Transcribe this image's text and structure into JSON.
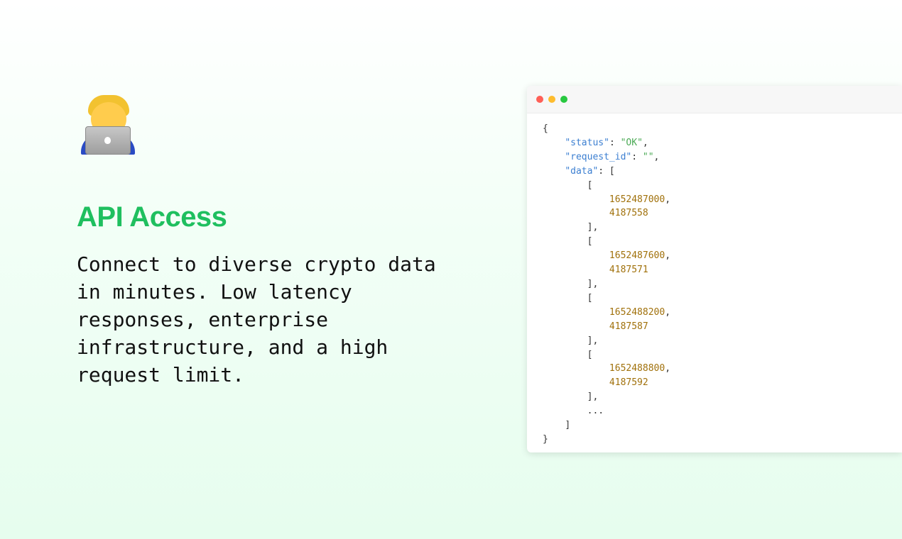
{
  "hero": {
    "title": "API Access",
    "description": "Connect to diverse crypto data in minutes. Low latency responses, enterprise infrastructure, and a high request limit.",
    "icon": "technologist-emoji-icon"
  },
  "code_window": {
    "dot_colors": [
      "#ff5f57",
      "#febc2e",
      "#28c840"
    ],
    "lines": [
      {
        "indent": "",
        "parts": [
          {
            "t": "pun",
            "v": "{"
          }
        ]
      },
      {
        "indent": "    ",
        "parts": [
          {
            "t": "key",
            "v": "\"status\""
          },
          {
            "t": "pun",
            "v": ": "
          },
          {
            "t": "str",
            "v": "\"OK\""
          },
          {
            "t": "pun",
            "v": ","
          }
        ]
      },
      {
        "indent": "    ",
        "parts": [
          {
            "t": "key",
            "v": "\"request_id\""
          },
          {
            "t": "pun",
            "v": ": "
          },
          {
            "t": "str",
            "v": "\"\""
          },
          {
            "t": "pun",
            "v": ","
          }
        ]
      },
      {
        "indent": "    ",
        "parts": [
          {
            "t": "key",
            "v": "\"data\""
          },
          {
            "t": "pun",
            "v": ": ["
          }
        ]
      },
      {
        "indent": "        ",
        "parts": [
          {
            "t": "pun",
            "v": "["
          }
        ]
      },
      {
        "indent": "            ",
        "parts": [
          {
            "t": "num",
            "v": "1652487000"
          },
          {
            "t": "pun",
            "v": ","
          }
        ]
      },
      {
        "indent": "            ",
        "parts": [
          {
            "t": "num",
            "v": "4187558"
          }
        ]
      },
      {
        "indent": "        ",
        "parts": [
          {
            "t": "pun",
            "v": "],"
          }
        ]
      },
      {
        "indent": "        ",
        "parts": [
          {
            "t": "pun",
            "v": "["
          }
        ]
      },
      {
        "indent": "            ",
        "parts": [
          {
            "t": "num",
            "v": "1652487600"
          },
          {
            "t": "pun",
            "v": ","
          }
        ]
      },
      {
        "indent": "            ",
        "parts": [
          {
            "t": "num",
            "v": "4187571"
          }
        ]
      },
      {
        "indent": "        ",
        "parts": [
          {
            "t": "pun",
            "v": "],"
          }
        ]
      },
      {
        "indent": "        ",
        "parts": [
          {
            "t": "pun",
            "v": "["
          }
        ]
      },
      {
        "indent": "            ",
        "parts": [
          {
            "t": "num",
            "v": "1652488200"
          },
          {
            "t": "pun",
            "v": ","
          }
        ]
      },
      {
        "indent": "            ",
        "parts": [
          {
            "t": "num",
            "v": "4187587"
          }
        ]
      },
      {
        "indent": "        ",
        "parts": [
          {
            "t": "pun",
            "v": "],"
          }
        ]
      },
      {
        "indent": "        ",
        "parts": [
          {
            "t": "pun",
            "v": "["
          }
        ]
      },
      {
        "indent": "            ",
        "parts": [
          {
            "t": "num",
            "v": "1652488800"
          },
          {
            "t": "pun",
            "v": ","
          }
        ]
      },
      {
        "indent": "            ",
        "parts": [
          {
            "t": "num",
            "v": "4187592"
          }
        ]
      },
      {
        "indent": "        ",
        "parts": [
          {
            "t": "pun",
            "v": "],"
          }
        ]
      },
      {
        "indent": "        ",
        "parts": [
          {
            "t": "pun",
            "v": "..."
          }
        ]
      },
      {
        "indent": "    ",
        "parts": [
          {
            "t": "pun",
            "v": "]"
          }
        ]
      },
      {
        "indent": "",
        "parts": [
          {
            "t": "pun",
            "v": "}"
          }
        ]
      }
    ]
  }
}
